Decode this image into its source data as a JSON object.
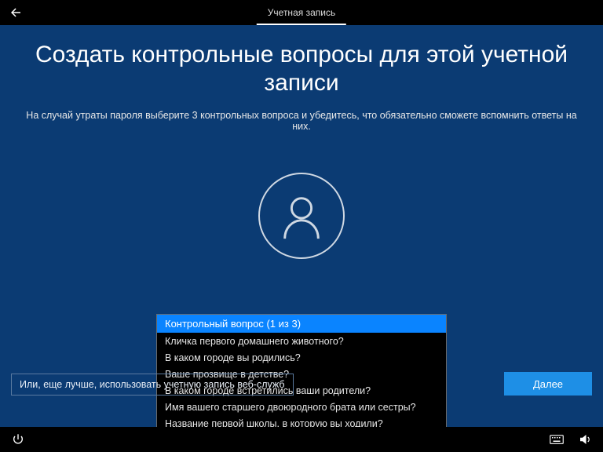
{
  "topbar": {
    "tab_label": "Учетная запись"
  },
  "page": {
    "title": "Создать контрольные вопросы для этой учетной записи",
    "subtitle": "На случай утраты пароля выберите 3 контрольных вопроса и убедитесь, что обязательно сможете вспомнить ответы на них."
  },
  "dropdown": {
    "header": "Контрольный вопрос (1 из 3)",
    "options": [
      "Кличка первого домашнего животного?",
      "В каком городе вы родились?",
      "Ваше прозвище в детстве?",
      "В каком городе встретились ваши родители?",
      "Имя вашего старшего двоюродного брата или сестры?",
      "Название первой школы, в которую вы ходили?"
    ]
  },
  "alt_link": "Или, еще лучше, использовать учетную запись веб-служб",
  "next_button": "Далее"
}
